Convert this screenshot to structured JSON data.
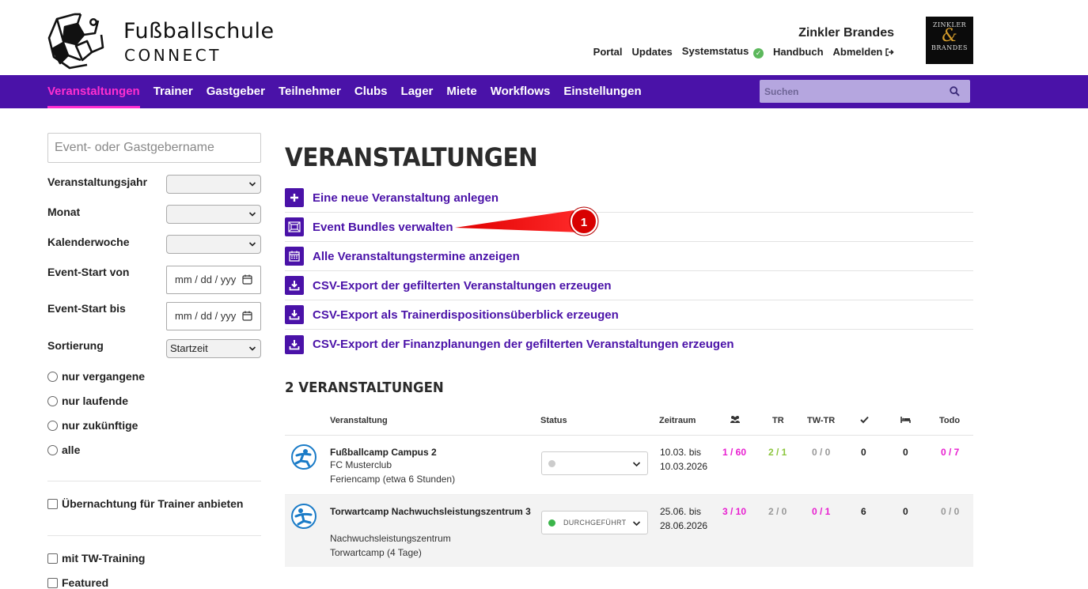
{
  "brand": {
    "title": "Fußballschule",
    "subtitle": "CONNECT",
    "company": "Zinkler Brandes",
    "partner_logo": {
      "line1": "ZINKLER",
      "ampersand": "&",
      "line2": "BRANDES",
      "accent_color": "#d39b2b"
    }
  },
  "top_links": {
    "portal": "Portal",
    "updates": "Updates",
    "systemstatus": "Systemstatus",
    "handbuch": "Handbuch",
    "abmelden": "Abmelden"
  },
  "nav": {
    "items": [
      "Veranstaltungen",
      "Trainer",
      "Gastgeber",
      "Teilnehmer",
      "Clubs",
      "Lager",
      "Miete",
      "Workflows",
      "Einstellungen"
    ],
    "active": "Veranstaltungen",
    "search_placeholder": "Suchen",
    "bar_color": "#4a12a8",
    "active_color": "#ff2fd0"
  },
  "filters": {
    "name_placeholder": "Event- oder Gastgebername",
    "year_label": "Veranstaltungsjahr",
    "month_label": "Monat",
    "week_label": "Kalenderwoche",
    "start_from_label": "Event-Start von",
    "start_to_label": "Event-Start bis",
    "date_placeholder": "mm / dd / yyy",
    "sort_label": "Sortierung",
    "sort_value": "Startzeit",
    "radios": [
      "nur vergangene",
      "nur laufende",
      "nur zukünftige",
      "alle"
    ],
    "overnight_label": "Übernachtung für Trainer anbieten",
    "tw_training_label": "mit TW-Training",
    "featured_label": "Featured"
  },
  "main": {
    "title": "VERANSTALTUNGEN",
    "actions": [
      {
        "label": "Eine neue Veranstaltung anlegen",
        "icon": "plus-icon"
      },
      {
        "label": "Event Bundles verwalten",
        "icon": "bundle-icon"
      },
      {
        "label": "Alle Veranstaltungstermine anzeigen",
        "icon": "calendar-icon"
      },
      {
        "label": "CSV-Export der gefilterten Veranstaltungen erzeugen",
        "icon": "download-icon"
      },
      {
        "label": "CSV-Export als Trainerdispositionsüberblick erzeugen",
        "icon": "download-icon"
      },
      {
        "label": "CSV-Export der Finanzplanungen der gefilterten Veranstaltungen erzeugen",
        "icon": "download-icon"
      }
    ],
    "annotation_number": "1",
    "count_title": "2 VERANSTALTUNGEN"
  },
  "table": {
    "headers": {
      "event": "Veranstaltung",
      "status": "Status",
      "period": "Zeitraum",
      "participants_icon": "users-icon",
      "tr": "TR",
      "twtr": "TW-TR",
      "done_icon": "check-icon",
      "bed_icon": "bed-icon",
      "todo": "Todo"
    },
    "rows": [
      {
        "name": "Fußballcamp Campus 2",
        "club": "FC Musterclub",
        "type": "Feriencamp (etwa 6 Stunden)",
        "status": "",
        "status_color": "#cccccc",
        "time_from": "10.03. bis",
        "time_to": "10.03.2026",
        "participants": "1 / 60",
        "tr": "2 / 1",
        "twtr": "0 / 0",
        "done": "0",
        "beds": "0",
        "todo": "0 / 7"
      },
      {
        "name": "Torwartcamp Nachwuchsleistungszentrum 3",
        "club": "Nachwuchsleistungszentrum",
        "type": "Torwartcamp (4 Tage)",
        "status": "DURCHGEFÜHRT",
        "status_color": "#3bb54a",
        "time_from": "25.06. bis",
        "time_to": "28.06.2026",
        "participants": "3 / 10",
        "tr": "2 / 0",
        "twtr": "0 / 1",
        "done": "6",
        "beds": "0",
        "todo": "0 / 0"
      }
    ]
  }
}
